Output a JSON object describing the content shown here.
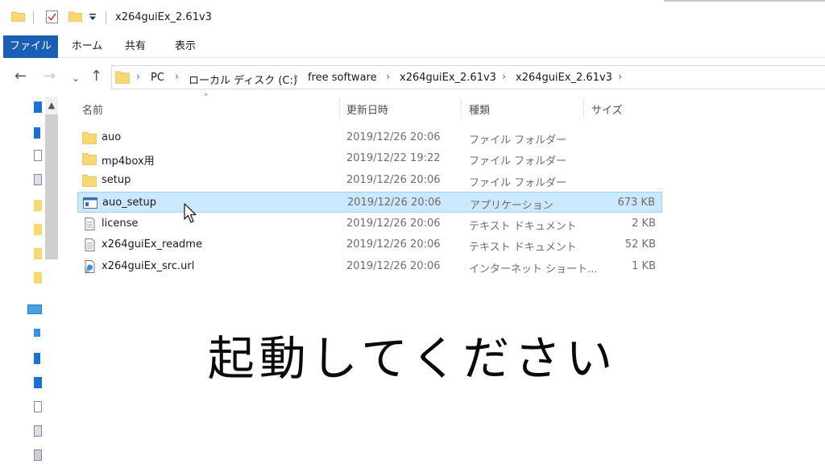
{
  "window": {
    "title": "x264guiEx_2.61v3"
  },
  "ribbon": {
    "tabs": [
      {
        "label": "ファイル",
        "active": true
      },
      {
        "label": "ホーム"
      },
      {
        "label": "共有"
      },
      {
        "label": "表示"
      }
    ]
  },
  "address": {
    "breadcrumbs": [
      "PC",
      "ローカル ディスク (C:)",
      "free software",
      "x264guiEx_2.61v3",
      "x264guiEx_2.61v3"
    ]
  },
  "columns": {
    "name": "名前",
    "date": "更新日時",
    "type": "種類",
    "size": "サイズ"
  },
  "files": [
    {
      "name": "auo",
      "date": "2019/12/26 20:06",
      "type": "ファイル フォルダー",
      "size": "",
      "icon": "folder-icon"
    },
    {
      "name": "mp4box用",
      "date": "2019/12/22 19:22",
      "type": "ファイル フォルダー",
      "size": "",
      "icon": "folder-icon"
    },
    {
      "name": "setup",
      "date": "2019/12/26 20:06",
      "type": "ファイル フォルダー",
      "size": "",
      "icon": "folder-icon"
    },
    {
      "name": "auo_setup",
      "date": "2019/12/26 20:06",
      "type": "アプリケーション",
      "size": "673 KB",
      "icon": "application-icon",
      "selected": true
    },
    {
      "name": "license",
      "date": "2019/12/26 20:06",
      "type": "テキスト ドキュメント",
      "size": "2 KB",
      "icon": "text-document-icon"
    },
    {
      "name": "x264guiEx_readme",
      "date": "2019/12/26 20:06",
      "type": "テキスト ドキュメント",
      "size": "52 KB",
      "icon": "text-document-icon"
    },
    {
      "name": "x264guiEx_src.url",
      "date": "2019/12/26 20:06",
      "type": "インターネット ショート...",
      "size": "1 KB",
      "icon": "internet-shortcut-icon"
    }
  ],
  "overlay": {
    "caption": "起動してください"
  },
  "colors": {
    "accent": "#1a5fb4",
    "selection": "#cce8ff",
    "folder": "#f8d775"
  }
}
